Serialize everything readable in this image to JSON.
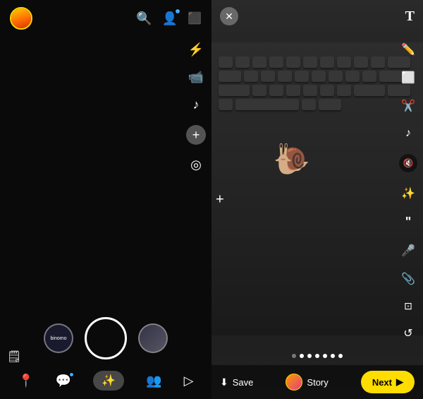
{
  "left": {
    "toolbar": {
      "flash_icon": "⚡",
      "video_icon": "📹",
      "music_icon": "♪",
      "plus_icon": "+",
      "scan_icon": "◎"
    },
    "bottom_nav": {
      "map_icon": "📍",
      "chat_icon": "💬",
      "camera_icon": "✨",
      "friends_icon": "👥",
      "stories_icon": "▷"
    },
    "lens_options": [
      {
        "label": "binomo",
        "type": "text"
      },
      {
        "label": "",
        "type": "preview"
      }
    ],
    "sticker_icon": "🗒"
  },
  "right": {
    "top": {
      "close": "✕",
      "text_tool": "T"
    },
    "toolbar": {
      "pencil": "✏",
      "clipboard": "⊡",
      "scissors": "✂",
      "music": "♪",
      "mute": "🔇",
      "sparkle": "✨",
      "quote": "❝",
      "mic": "🎤",
      "paperclip": "📎",
      "crop": "⊞",
      "loop": "↺"
    },
    "add_icon": "+",
    "snail_emoji": "🐌",
    "dots": [
      false,
      true,
      true,
      true,
      true,
      true,
      true
    ],
    "bottom": {
      "save_label": "Save",
      "story_label": "Story",
      "next_label": "Next",
      "next_arrow": "▶"
    }
  }
}
